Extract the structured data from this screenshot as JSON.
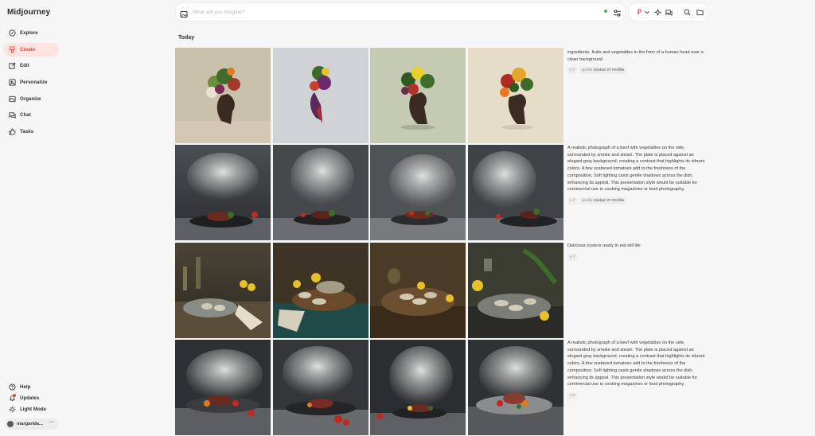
{
  "app": {
    "name": "Midjourney"
  },
  "sidebar": {
    "items": [
      {
        "label": "Explore",
        "icon": "compass-icon"
      },
      {
        "label": "Create",
        "icon": "brush-icon",
        "active": true
      },
      {
        "label": "Edit",
        "icon": "edit-icon"
      },
      {
        "label": "Personalize",
        "icon": "personalize-icon"
      },
      {
        "label": "Organize",
        "icon": "folder-image-icon"
      },
      {
        "label": "Chat",
        "icon": "chat-icon"
      },
      {
        "label": "Tasks",
        "icon": "thumbs-up-icon"
      }
    ],
    "bottom": [
      {
        "label": "Help",
        "icon": "help-icon"
      },
      {
        "label": "Updates",
        "icon": "bell-icon",
        "badge": true
      },
      {
        "label": "Light Mode",
        "icon": "sun-icon"
      }
    ],
    "user": {
      "name": "margarida...",
      "more": "···"
    }
  },
  "prompt": {
    "placeholder": "What will you imagine?"
  },
  "section": {
    "title": "Today"
  },
  "colors": {
    "accent": "#e5483d",
    "active_bg": "#fde3e1",
    "status_green": "#2ebd6b"
  },
  "rows": [
    {
      "prompt": "ingredients, fruits and vegetables in the form of a human head over a clean background",
      "tags": [
        {
          "text": "v 7"
        },
        {
          "prefix": "profile",
          "text": "Global V7 Profile"
        }
      ],
      "images": [
        "fruit-head-1",
        "fruit-head-2",
        "fruit-head-3",
        "fruit-head-4"
      ]
    },
    {
      "prompt": "A realistic photograph of a beef with vegetables on the side, surrounded by smoke and steam. The plate is placed against an elegant gray background, creating a contrast that highlights its vibrant colors. A few scattered tomatoes add to the freshness of the composition. Soft lighting casts gentle shadows across the dish, enhancing its appeal. This presentation style would be suitable for commercial use in cooking magazines or food photography.",
      "tags": [
        {
          "text": "v 7"
        },
        {
          "prefix": "profile",
          "text": "Global V7 Profile"
        }
      ],
      "images": [
        "beef-smoke-1",
        "beef-smoke-2",
        "beef-smoke-3",
        "beef-smoke-4"
      ]
    },
    {
      "prompt": "Delicious oysters ready to eat still life",
      "tags": [
        {
          "text": "v 7"
        }
      ],
      "images": [
        "oysters-1",
        "oysters-2",
        "oysters-3",
        "oysters-4"
      ]
    },
    {
      "prompt": "A realistic photograph of a beef with vegetables on the side, surrounded by smoke and steam. The plate is placed against an elegant gray background, creating a contrast that highlights its vibrant colors. A few scattered tomatoes add to the freshness of the composition. Soft lighting casts gentle shadows across the dish, enhancing its appeal. This presentation style would be suitable for commercial use in cooking magazines or food photography.",
      "tags": [
        {
          "text": "v 7"
        }
      ],
      "images": [
        "beef-steam-1",
        "beef-steam-2",
        "beef-steam-3",
        "beef-steam-4"
      ]
    }
  ]
}
